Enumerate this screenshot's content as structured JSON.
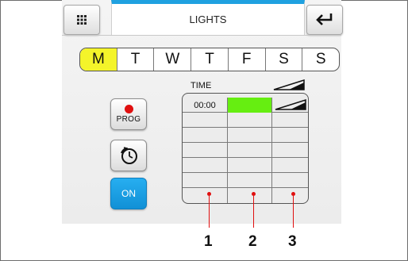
{
  "header": {
    "title": "LIGHTS",
    "menu_icon": "grid-icon",
    "back_icon": "return-arrow-icon",
    "accent_color": "#1fa1e0"
  },
  "days": [
    {
      "label": "M",
      "active": true
    },
    {
      "label": "T",
      "active": false
    },
    {
      "label": "W",
      "active": false
    },
    {
      "label": "T",
      "active": false
    },
    {
      "label": "F",
      "active": false
    },
    {
      "label": "S",
      "active": false
    },
    {
      "label": "S",
      "active": false
    }
  ],
  "buttons": {
    "prog_label": "PROG",
    "timer_icon": "timer-icon",
    "on_label": "ON"
  },
  "table": {
    "time_header": "TIME",
    "level_icon": "level-ramp-icon",
    "rows": [
      {
        "time": "00:00",
        "state_color": "#66ee11"
      },
      {
        "time": "",
        "state_color": ""
      },
      {
        "time": "",
        "state_color": ""
      },
      {
        "time": "",
        "state_color": ""
      },
      {
        "time": "",
        "state_color": ""
      },
      {
        "time": "",
        "state_color": ""
      }
    ]
  },
  "callouts": [
    "1",
    "2",
    "3"
  ],
  "colors": {
    "active_day": "#f4f42a",
    "on_button": "#1fa1e0",
    "record_dot": "#e01010",
    "callout_line": "#e01010"
  }
}
